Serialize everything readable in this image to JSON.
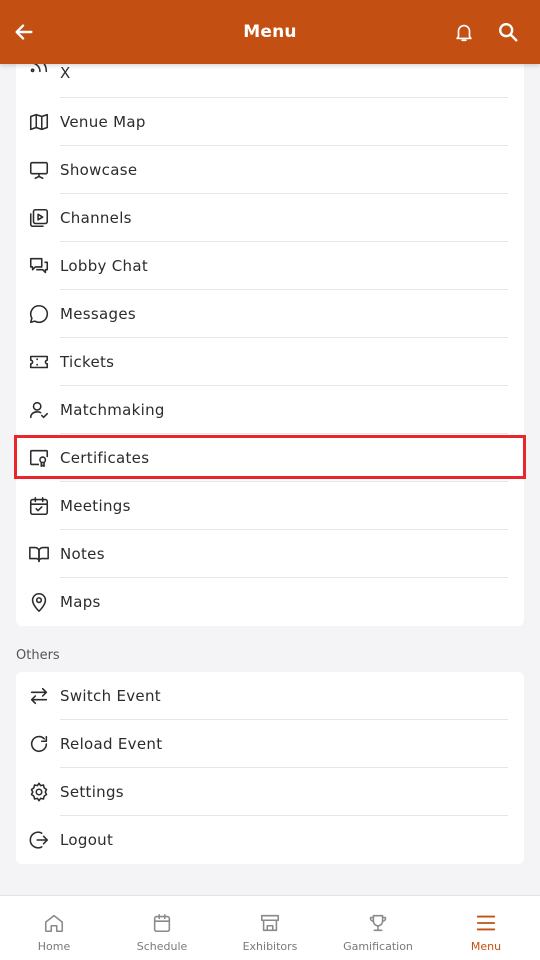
{
  "header": {
    "title": "Menu"
  },
  "menu_items": [
    {
      "label": "X",
      "icon": "rss-icon"
    },
    {
      "label": "Venue Map",
      "icon": "map-icon"
    },
    {
      "label": "Showcase",
      "icon": "presentation-icon"
    },
    {
      "label": "Channels",
      "icon": "video-channel-icon"
    },
    {
      "label": "Lobby Chat",
      "icon": "chat-bubbles-icon"
    },
    {
      "label": "Messages",
      "icon": "message-circle-icon"
    },
    {
      "label": "Tickets",
      "icon": "ticket-icon"
    },
    {
      "label": "Matchmaking",
      "icon": "user-check-icon"
    },
    {
      "label": "Certificates",
      "icon": "certificate-icon"
    },
    {
      "label": "Meetings",
      "icon": "calendar-check-icon"
    },
    {
      "label": "Notes",
      "icon": "book-open-icon"
    },
    {
      "label": "Maps",
      "icon": "map-pin-icon"
    }
  ],
  "others": {
    "label": "Others",
    "items": [
      {
        "label": "Switch Event",
        "icon": "arrows-swap-icon"
      },
      {
        "label": "Reload Event",
        "icon": "reload-icon"
      },
      {
        "label": "Settings",
        "icon": "gear-icon"
      },
      {
        "label": "Logout",
        "icon": "logout-icon"
      }
    ]
  },
  "bottom_nav": [
    {
      "label": "Home",
      "icon": "home-icon",
      "active": false
    },
    {
      "label": "Schedule",
      "icon": "calendar-icon",
      "active": false
    },
    {
      "label": "Exhibitors",
      "icon": "booth-icon",
      "active": false
    },
    {
      "label": "Gamification",
      "icon": "trophy-icon",
      "active": false
    },
    {
      "label": "Menu",
      "icon": "hamburger-icon",
      "active": true
    }
  ],
  "colors": {
    "brand": "#c44f12",
    "highlight": "#e8262b",
    "background": "#f4f4f6"
  }
}
